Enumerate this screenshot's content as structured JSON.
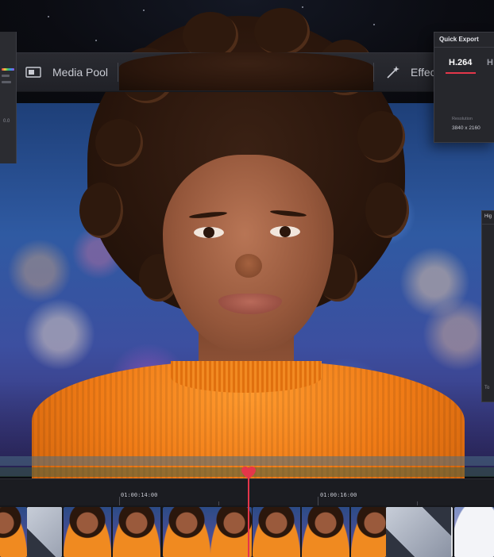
{
  "page_toolbar": {
    "tabs": [
      {
        "label": "Media Pool",
        "icon": "media-pool-icon"
      },
      {
        "label": "Effects",
        "icon": "effects-magic-wand-icon"
      }
    ]
  },
  "quick_export": {
    "title": "Quick Export",
    "formats": [
      "H.264",
      "H"
    ],
    "selected_format": "H.264",
    "resolution_label": "Resolution",
    "resolution_value": "3840 x 2160",
    "accent_color": "#e4364a"
  },
  "right_panel": {
    "title": "Hig",
    "footer": "To"
  },
  "left_panel": {
    "value": "0.0"
  },
  "timeline": {
    "timecodes": [
      "01:00:14:00",
      "01:00:16:00"
    ],
    "playhead_color": "#e4364a",
    "clips": [
      {
        "kind": "face"
      },
      {
        "kind": "transition"
      },
      {
        "kind": "face"
      },
      {
        "kind": "face"
      },
      {
        "kind": "face"
      },
      {
        "kind": "face"
      },
      {
        "kind": "transition"
      },
      {
        "kind": "snow"
      }
    ]
  },
  "effects_label": "Effec"
}
